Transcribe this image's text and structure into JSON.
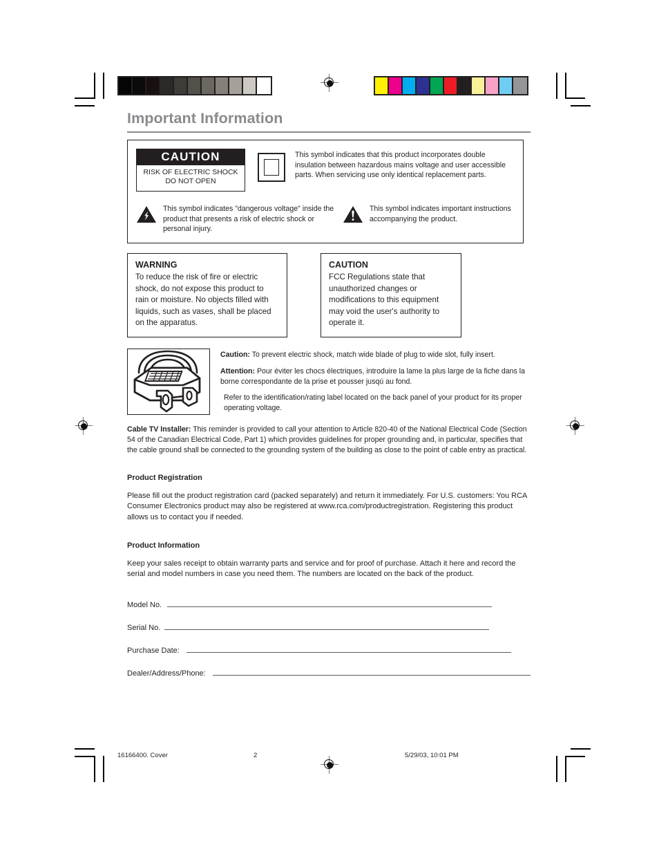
{
  "page_title": "Important Information",
  "symbol_panel": {
    "caution_label": {
      "heading": "CAUTION",
      "subtext": "RISK OF ELECTRIC SHOCK DO NOT OPEN"
    },
    "double_insulation_text": "This symbol indicates that this product incorporates double insulation between hazardous mains voltage and user accessible parts. When servicing use only identical replacement parts.",
    "dangerous_voltage_text": "This symbol indicates \"dangerous voltage\" inside the product that presents a risk of electric shock or personal injury.",
    "important_instructions_text": "This symbol indicates important instructions accompanying the product."
  },
  "warning_box": {
    "title": "WARNING",
    "body": "To reduce the risk of fire or electric shock, do not expose this product to rain or moisture. No objects filled with liquids, such as vases, shall be placed on the apparatus."
  },
  "fcc_box": {
    "title": "CAUTION",
    "body": "FCC Regulations state that unauthorized changes or modifications to this equipment may void the user's authority to operate it."
  },
  "plug_section": {
    "caution_label": "Caution:",
    "caution_text": " To prevent electric shock, match wide blade of plug to wide slot, fully insert.",
    "attention_label": "Attention:",
    "attention_text": " Pour éviter les chocs électriques, introduire la lame la plus large de la fiche dans la borne correspondante de la prise et pousser jusqú au fond.",
    "rating_text": "Refer to the identification/rating label located on the back panel of your product for its proper operating voltage."
  },
  "cable_note": {
    "label": "Cable TV Installer:",
    "text": " This reminder is provided to call your attention to Article 820-40 of the National Electrical Code (Section 54 of the Canadian Electrical Code, Part 1) which provides guidelines for proper grounding and, in particular, specifies that the cable ground shall be connected to the grounding system of the building as close to the point of cable entry as practical."
  },
  "product_registration": {
    "heading": "Product Registration",
    "body": "Please fill out the product registration card (packed separately) and return it immediately.  For U.S. customers: You RCA Consumer Electronics product may also be registered at www.rca.com/productregistration. Registering this product allows us to contact you if needed."
  },
  "product_information": {
    "heading": "Product Information",
    "body": "Keep your sales receipt to obtain warranty parts and service and for proof of purchase. Attach it here and record the serial and model numbers in case you need them. The numbers are located on the back of the product."
  },
  "form_fields": [
    {
      "label": "Model No.",
      "value": ""
    },
    {
      "label": "Serial No.",
      "value": ""
    },
    {
      "label": "Purchase Date:",
      "value": ""
    },
    {
      "label": "Dealer/Address/Phone:",
      "value": ""
    }
  ],
  "footer": {
    "job": "16166400. Cover",
    "page_number": "2",
    "timestamp": "5/29/03, 10:01 PM"
  },
  "calibration": {
    "grayscale_swatches": [
      "#050505",
      "#0b0b0b",
      "#17100e",
      "#2c2a28",
      "#3e3c39",
      "#525049",
      "#6b6861",
      "#858079",
      "#a5a099",
      "#cdc9c4",
      "#ffffff"
    ],
    "color_swatches": [
      "#fff200",
      "#ec008c",
      "#00aeef",
      "#2e3192",
      "#00a651",
      "#ed1c24",
      "#231f20",
      "#fbf09a",
      "#f7a3c6",
      "#6fcdf2",
      "#939598"
    ]
  },
  "colors": {
    "title_gray": "#8a8a8e",
    "ink": "#231f20",
    "rule_gray": "#58595b"
  }
}
